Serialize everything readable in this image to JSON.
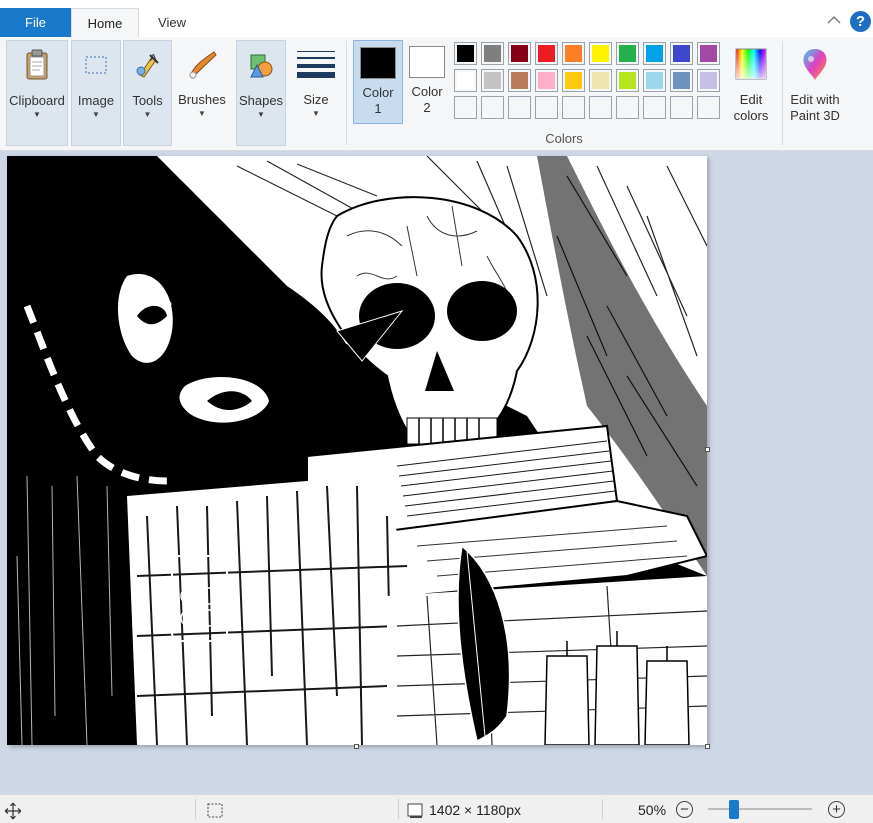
{
  "tabs": {
    "file": "File",
    "home": "Home",
    "view": "View"
  },
  "help_label": "?",
  "ribbon": {
    "clipboard": "Clipboard",
    "image": "Image",
    "tools": "Tools",
    "brushes": "Brushes",
    "shapes": "Shapes",
    "size": "Size",
    "color1_line1": "Color",
    "color1_line2": "1",
    "color2_line1": "Color",
    "color2_line2": "2",
    "colors_caption": "Colors",
    "edit_colors_line1": "Edit",
    "edit_colors_line2": "colors",
    "paint3d_line1": "Edit with",
    "paint3d_line2": "Paint 3D"
  },
  "colors": {
    "color1": "#000000",
    "color2": "#ffffff",
    "palette_row1": [
      "#000000",
      "#7f7f7f",
      "#880015",
      "#ed1c24",
      "#ff7f27",
      "#fff200",
      "#22b14c",
      "#00a2e8",
      "#3f48cc",
      "#a349a4"
    ],
    "palette_row2": [
      "#ffffff",
      "#c3c3c3",
      "#b97a57",
      "#ffaec9",
      "#ffc90e",
      "#efe4b0",
      "#b5e61d",
      "#99d9ea",
      "#7092be",
      "#c8bfe7"
    ],
    "accent": "#1979ca"
  },
  "status": {
    "image_size": "1402 × 1180px",
    "zoom": "50%",
    "zoom_level": 0.3
  }
}
